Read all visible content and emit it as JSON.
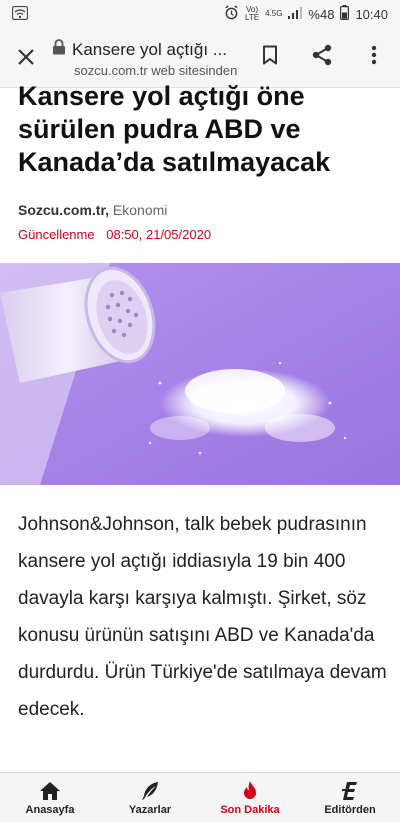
{
  "status_bar": {
    "network_top": "Vo)",
    "network_bottom": "LTE",
    "signal_label": "4.5G",
    "battery": "%48",
    "time": "10:40"
  },
  "browser": {
    "page_title": "Kansere yol açtığı ...",
    "site_line": "sozcu.com.tr web sitesinden"
  },
  "article": {
    "headline": "Kansere yol açtığı öne sürülen pudra ABD ve Kanada’da satılmayacak",
    "source": "Sozcu.com.tr,",
    "category": "Ekonomi",
    "updated_label": "Güncellenme",
    "updated_value": "08:50, 21/05/2020",
    "body": "Johnson&Johnson, talk bebek pudrasının kansere yol açtığı iddiasıyla 19 bin 400 davayla karşı karşıya kalmıştı. Şirket, söz konusu ürünün satışını ABD ve Kanada'da durdurdu. Ürün Türkiye'de satılmaya devam edecek."
  },
  "bottom_nav": {
    "items": [
      {
        "label": "Anasayfa",
        "icon": "home-icon"
      },
      {
        "label": "Yazarlar",
        "icon": "quill-icon"
      },
      {
        "label": "Son Dakika",
        "icon": "flame-icon"
      },
      {
        "label": "Editörden",
        "icon": "editor-e-icon"
      }
    ]
  },
  "colors": {
    "accent_red": "#d0021b",
    "hero_purple": "#a782e8"
  }
}
